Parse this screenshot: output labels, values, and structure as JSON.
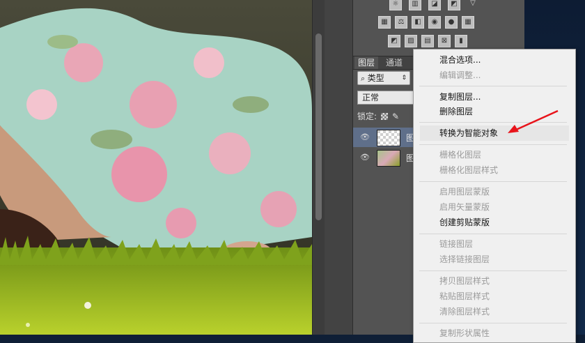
{
  "photo": {
    "description_icons": [
      "sleeping-person",
      "floral-fabric",
      "grass"
    ]
  },
  "adjustments_panel": {
    "rows": [
      [
        "brightness-icon",
        "levels-icon",
        "curves-icon",
        "exposure-icon",
        "triangle-icon"
      ],
      [
        "vibrance-icon",
        "balance-icon",
        "bw-icon",
        "photo-filter-icon",
        "channel-mixer-icon",
        "lookup-icon"
      ],
      [
        "invert-icon",
        "posterize-icon",
        "threshold-icon",
        "selective-color-icon",
        "gradient-map-icon"
      ]
    ]
  },
  "layers_panel": {
    "tabs": [
      "图层",
      "通道"
    ],
    "filter_label": "类型",
    "blend_mode": "正常",
    "lock_label": "锁定:",
    "layers": [
      {
        "name": "图"
      },
      {
        "name": "图"
      }
    ]
  },
  "context_menu": {
    "items": [
      {
        "label": "混合选项...",
        "enabled": true
      },
      {
        "label": "编辑调整...",
        "enabled": false
      },
      {
        "label": "复制图层...",
        "enabled": true
      },
      {
        "label": "删除图层",
        "enabled": true
      },
      {
        "label": "转换为智能对象",
        "enabled": true,
        "highlighted": true
      },
      {
        "label": "栅格化图层",
        "enabled": false
      },
      {
        "label": "栅格化图层样式",
        "enabled": false
      },
      {
        "label": "启用图层蒙版",
        "enabled": false
      },
      {
        "label": "启用矢量蒙版",
        "enabled": false
      },
      {
        "label": "创建剪贴蒙版",
        "enabled": true
      },
      {
        "label": "链接图层",
        "enabled": false
      },
      {
        "label": "选择链接图层",
        "enabled": false
      },
      {
        "label": "拷贝图层样式",
        "enabled": false
      },
      {
        "label": "粘贴图层样式",
        "enabled": false
      },
      {
        "label": "清除图层样式",
        "enabled": false
      },
      {
        "label": "复制形状属性",
        "enabled": false
      }
    ]
  },
  "annotation": {
    "arrow_color": "#e8141b"
  }
}
